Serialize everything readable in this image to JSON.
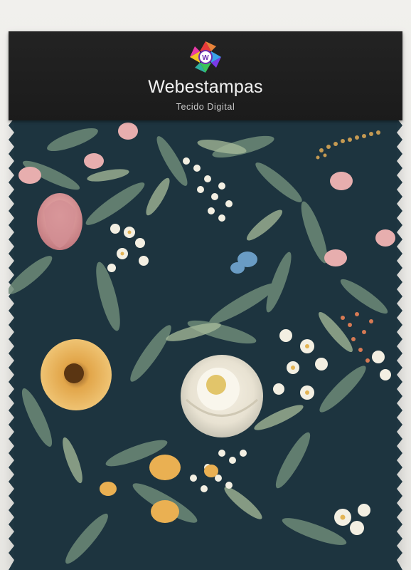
{
  "brand": {
    "name": "Webestampas",
    "tagline": "Tecido Digital",
    "logo_icon": "webestampas-logo-icon"
  },
  "swatch": {
    "pattern": "dark-teal-floral-print",
    "background_color": "#1e3440",
    "header_color": "#1f1f1f",
    "edge": "pinked-zigzag"
  }
}
